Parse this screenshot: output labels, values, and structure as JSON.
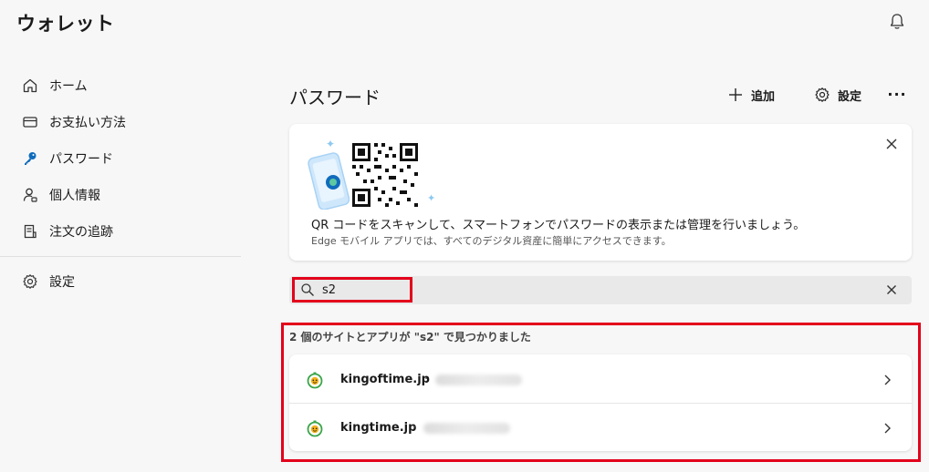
{
  "app": {
    "title": "ウォレット"
  },
  "sidebar": {
    "items": [
      {
        "label": "ホーム",
        "icon": "home-icon"
      },
      {
        "label": "お支払い方法",
        "icon": "credit-card-icon"
      },
      {
        "label": "パスワード",
        "icon": "key-icon",
        "active": true
      },
      {
        "label": "個人情報",
        "icon": "person-icon"
      },
      {
        "label": "注文の追跡",
        "icon": "receipt-icon"
      },
      {
        "label": "設定",
        "icon": "gear-icon"
      }
    ]
  },
  "main": {
    "title": "パスワード",
    "toolbar": {
      "add_label": "追加",
      "settings_label": "設定",
      "more_label": "···"
    },
    "qr_banner": {
      "text": "QR コードをスキャンして、スマートフォンでパスワードの表示または管理を行いましょう。",
      "subtext": "Edge モバイル アプリでは、すべてのデジタル資産に簡単にアクセスできます。"
    },
    "search": {
      "value": "s2",
      "placeholder": ""
    },
    "results": {
      "heading": "2 個のサイトとアプリが \"s2\" で見つかりました",
      "items": [
        {
          "site": "kingoftime.jp",
          "separator": "·"
        },
        {
          "site": "kingtime.jp",
          "separator": "·"
        }
      ]
    }
  },
  "colors": {
    "accent": "#0f6cbd",
    "highlight": "#e3001b",
    "background": "#f7f7f7"
  }
}
